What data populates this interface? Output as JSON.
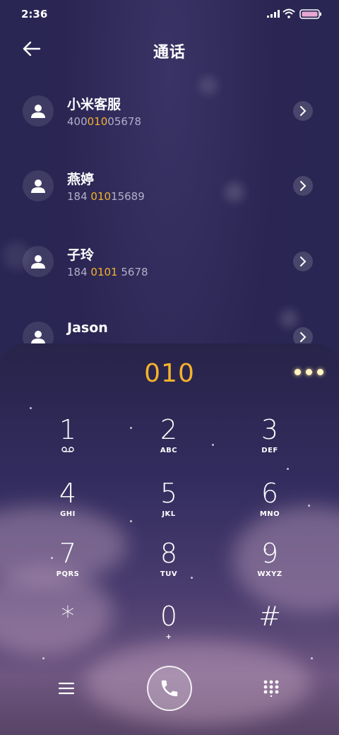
{
  "status_bar": {
    "time": "2:36"
  },
  "header": {
    "title": "通话"
  },
  "contacts": [
    {
      "name": "小米客服",
      "number_parts": [
        "400",
        "010",
        "05678"
      ]
    },
    {
      "name": "燕婷",
      "number_parts": [
        "184 ",
        "010",
        "15689"
      ]
    },
    {
      "name": "子玲",
      "number_parts": [
        "184 ",
        "0101",
        " 5678"
      ]
    },
    {
      "name": "Jason",
      "number_parts": [
        "",
        "",
        ""
      ]
    }
  ],
  "dialer": {
    "input": "010",
    "keys": [
      {
        "digit": "1",
        "letters": ""
      },
      {
        "digit": "2",
        "letters": "ABC"
      },
      {
        "digit": "3",
        "letters": "DEF"
      },
      {
        "digit": "4",
        "letters": "GHI"
      },
      {
        "digit": "5",
        "letters": "JKL"
      },
      {
        "digit": "6",
        "letters": "MNO"
      },
      {
        "digit": "7",
        "letters": "PQRS"
      },
      {
        "digit": "8",
        "letters": "TUV"
      },
      {
        "digit": "9",
        "letters": "WXYZ"
      },
      {
        "digit": "*",
        "letters": ""
      },
      {
        "digit": "0",
        "letters": "+"
      },
      {
        "digit": "#",
        "letters": ""
      }
    ]
  },
  "colors": {
    "accent": "#f5b22a",
    "background": "#2a2552",
    "secondary_text": "#b3aec9"
  },
  "icons": {
    "back": "arrow-left-icon",
    "avatar": "person-icon",
    "chevron": "chevron-right-icon",
    "voicemail": "voicemail-icon",
    "menu": "menu-icon",
    "call": "phone-icon",
    "keypad": "keypad-icon",
    "more": "more-dots-icon"
  }
}
